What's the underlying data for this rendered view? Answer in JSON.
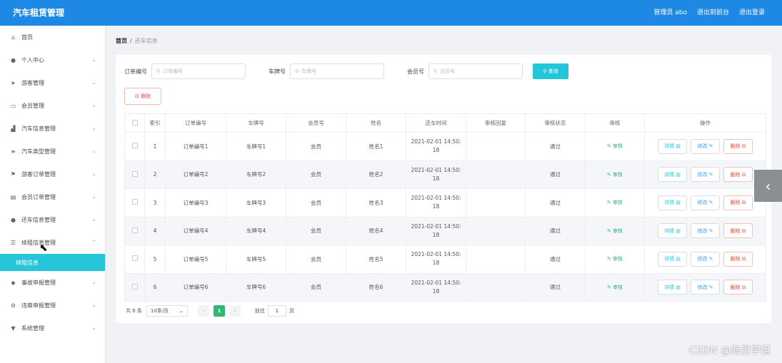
{
  "header": {
    "title": "汽车租赁管理",
    "user": "管理员 abo",
    "back_to_front": "退出到前台",
    "logout": "退出登录"
  },
  "sidebar": {
    "items": [
      {
        "label": "首页",
        "icon": "home-icon",
        "glyph": "⌂",
        "chev": ""
      },
      {
        "label": "个人中心",
        "icon": "user-icon",
        "glyph": "●",
        "chev": "⌄"
      },
      {
        "label": "游客管理",
        "icon": "send-icon",
        "glyph": "➤",
        "chev": "⌄"
      },
      {
        "label": "会员管理",
        "icon": "card-icon",
        "glyph": "▭",
        "chev": "⌄"
      },
      {
        "label": "汽车信息管理",
        "icon": "chart-icon",
        "glyph": "▟",
        "chev": "⌄"
      },
      {
        "label": "汽车类型管理",
        "icon": "list-icon",
        "glyph": "≡",
        "chev": "⌄"
      },
      {
        "label": "游客订单管理",
        "icon": "flag-icon",
        "glyph": "⚑",
        "chev": "⌄"
      },
      {
        "label": "会员订单管理",
        "icon": "clipboard-icon",
        "glyph": "▤",
        "chev": "⌄"
      },
      {
        "label": "还车信息管理",
        "icon": "person-icon",
        "glyph": "●",
        "chev": "⌄"
      },
      {
        "label": "续租信息管理",
        "icon": "menu-icon",
        "glyph": "☰",
        "chev": "⌃"
      }
    ],
    "sub_active": "续租信息",
    "items_after": [
      {
        "label": "事故申报管理",
        "icon": "shield-icon",
        "glyph": "◆",
        "chev": "⌄"
      },
      {
        "label": "违章申报管理",
        "icon": "gear-icon",
        "glyph": "⚙",
        "chev": "⌄"
      },
      {
        "label": "系统管理",
        "icon": "settings-icon",
        "glyph": "▼",
        "chev": "⌄"
      }
    ]
  },
  "breadcrumb": {
    "home": "首页",
    "sep": "/",
    "current": "还车信息"
  },
  "search": {
    "order_label": "订单编号",
    "order_placeholder": "订单编号",
    "plate_label": "车牌号",
    "plate_placeholder": "车牌号",
    "member_label": "会员号",
    "member_placeholder": "会员号",
    "query_button": "查询"
  },
  "delete_button": "删除",
  "table": {
    "headers": [
      "",
      "索引",
      "订单编号",
      "车牌号",
      "会员号",
      "姓名",
      "还车时间",
      "审核回复",
      "审核状态",
      "审核",
      "操作"
    ],
    "rows": [
      {
        "idx": "1",
        "order": "订单编号1",
        "plate": "车牌号1",
        "member": "会员",
        "name": "姓名1",
        "time1": "2021-02-01 14:50:",
        "time2": "18",
        "reply": "",
        "status": "通过",
        "audit": "✎ 审核"
      },
      {
        "idx": "2",
        "order": "订单编号2",
        "plate": "车牌号2",
        "member": "会员",
        "name": "姓名2",
        "time1": "2021-02-01 14:50:",
        "time2": "18",
        "reply": "",
        "status": "通过",
        "audit": "✎ 审核"
      },
      {
        "idx": "3",
        "order": "订单编号3",
        "plate": "车牌号3",
        "member": "会员",
        "name": "姓名3",
        "time1": "2021-02-01 14:50:",
        "time2": "18",
        "reply": "",
        "status": "通过",
        "audit": "✎ 审核"
      },
      {
        "idx": "4",
        "order": "订单编号4",
        "plate": "车牌号4",
        "member": "会员",
        "name": "姓名4",
        "time1": "2021-02-01 14:50:",
        "time2": "18",
        "reply": "",
        "status": "通过",
        "audit": "✎ 审核"
      },
      {
        "idx": "5",
        "order": "订单编号5",
        "plate": "车牌号5",
        "member": "会员",
        "name": "姓名5",
        "time1": "2021-02-01 14:50:",
        "time2": "18",
        "reply": "",
        "status": "通过",
        "audit": "✎ 审核"
      },
      {
        "idx": "6",
        "order": "订单编号6",
        "plate": "车牌号6",
        "member": "会员",
        "name": "姓名6",
        "time1": "2021-02-01 14:50:",
        "time2": "18",
        "reply": "",
        "status": "通过",
        "audit": "✎ 审核"
      }
    ],
    "op_detail": "详情 ▤",
    "op_edit": "修改 ✎",
    "op_delete": "删除 ⊟"
  },
  "pager": {
    "total": "共 6 条",
    "page_size": "10条/页",
    "prev": "‹",
    "page": "1",
    "next": "›",
    "goto": "前往",
    "goto_value": "1",
    "page_unit": "页"
  },
  "side_tab_glyph": "‹",
  "watermark": "CSDN @海灵学姐"
}
